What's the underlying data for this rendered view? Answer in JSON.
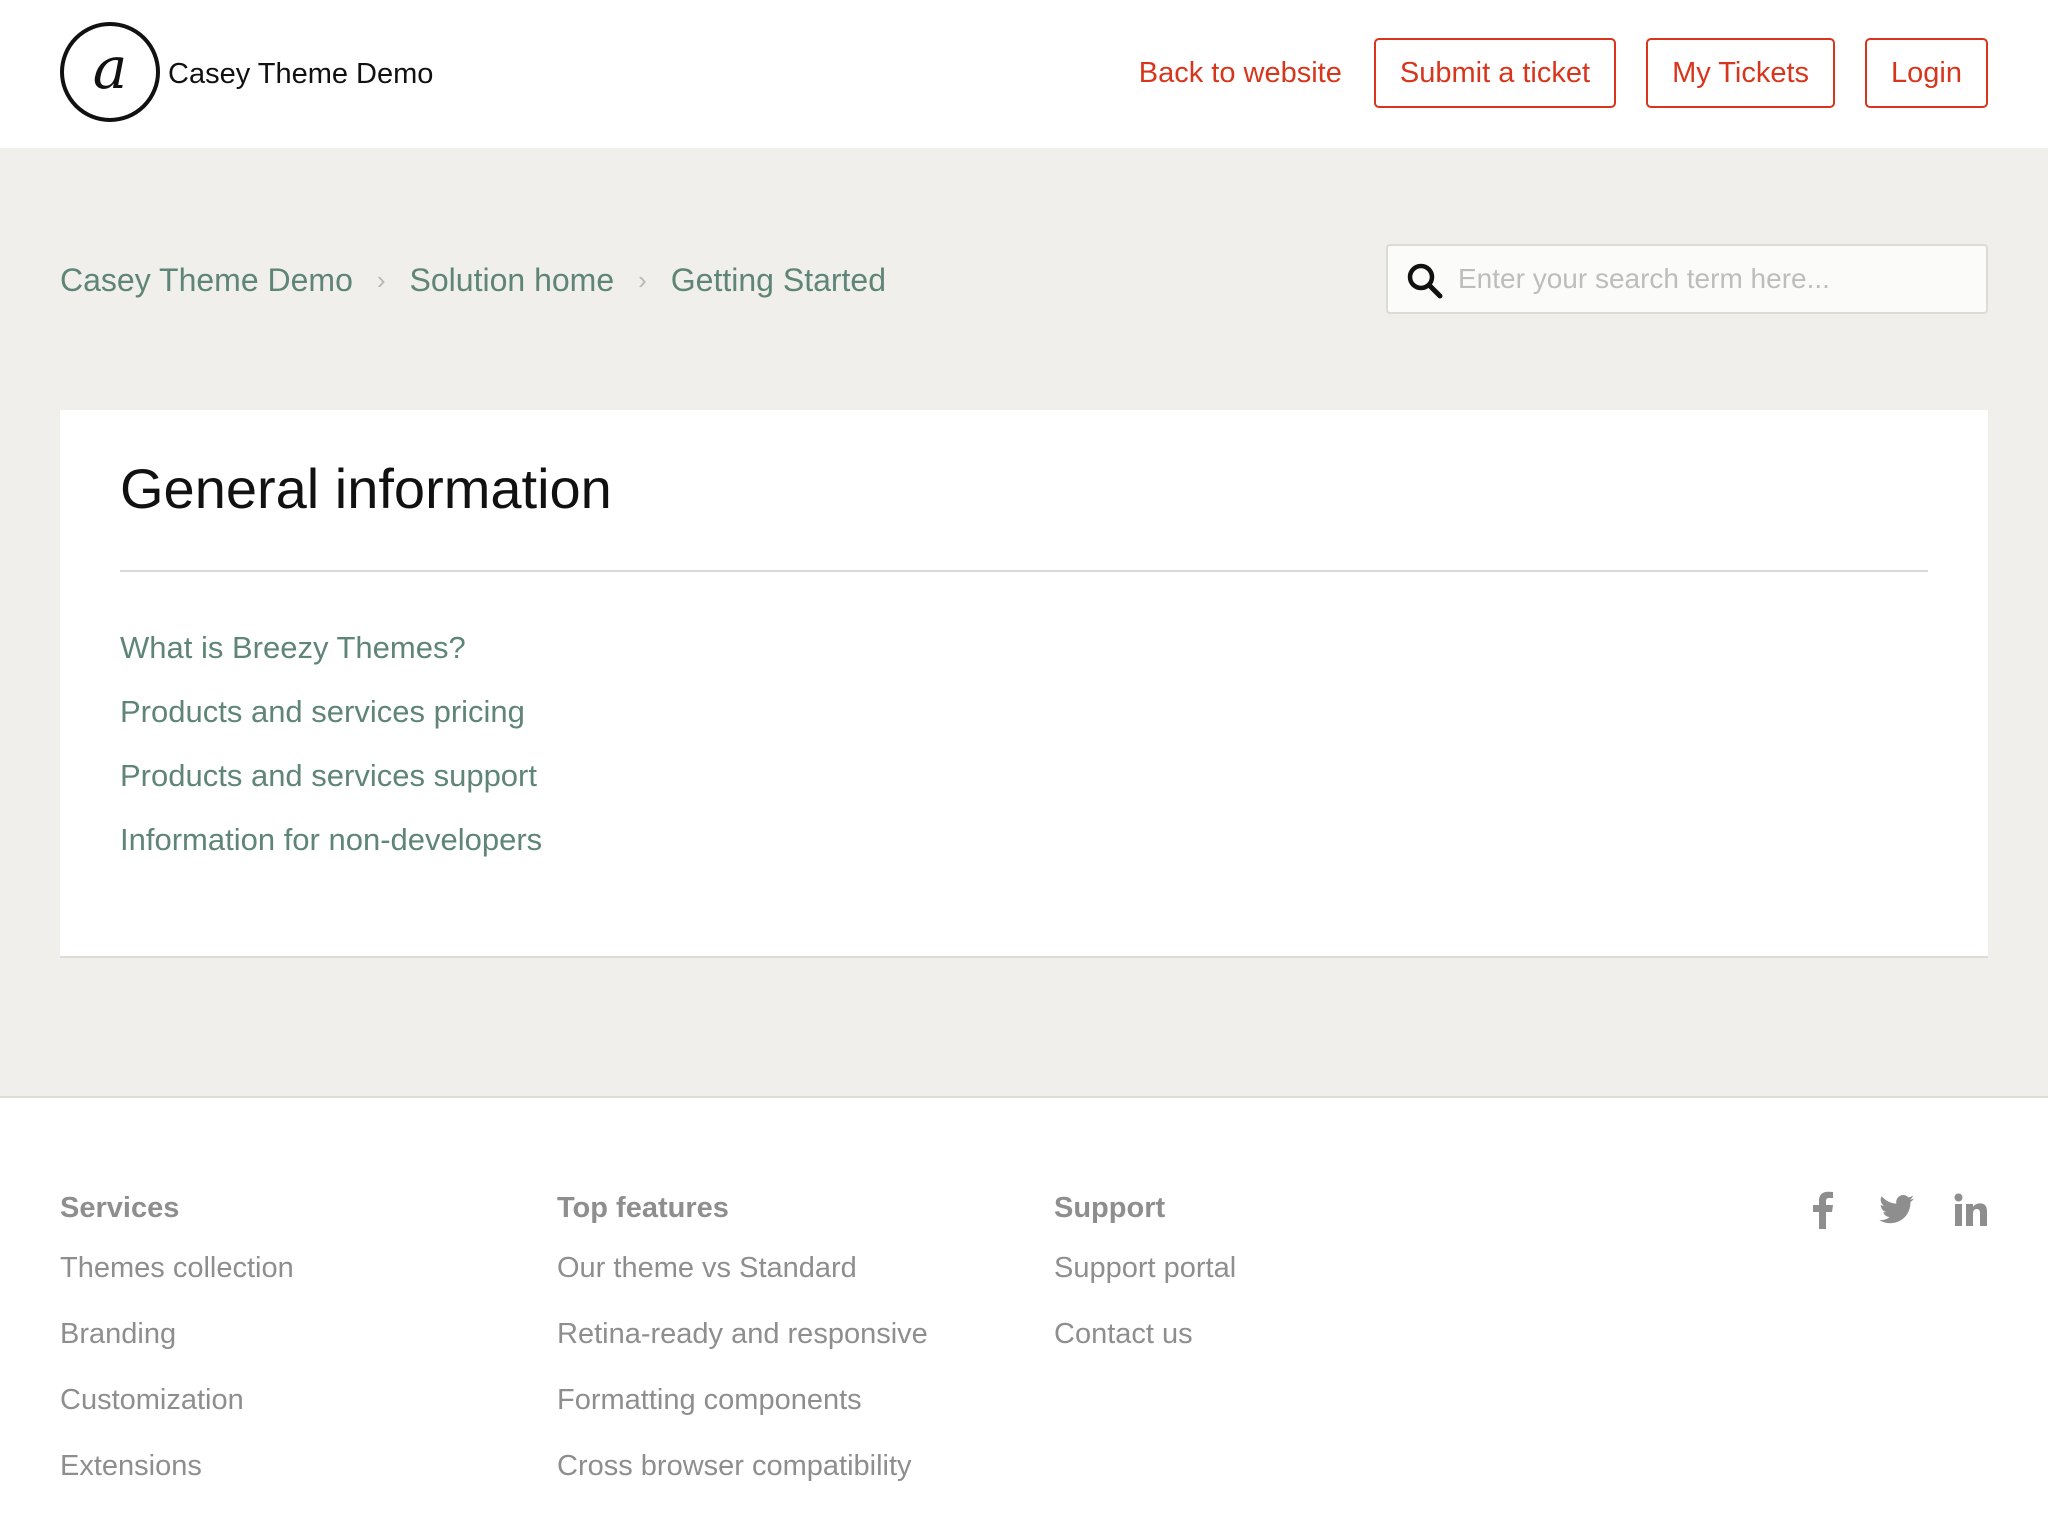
{
  "header": {
    "site_name": "Casey Theme Demo",
    "logo_glyph": "a",
    "back_link": "Back to website",
    "submit_ticket": "Submit a ticket",
    "my_tickets": "My Tickets",
    "login": "Login"
  },
  "breadcrumb": {
    "items": [
      "Casey Theme Demo",
      "Solution home",
      "Getting Started"
    ],
    "separator": "›"
  },
  "search": {
    "placeholder": "Enter your search term here..."
  },
  "section": {
    "title": "General information",
    "articles": [
      "What is Breezy Themes?",
      "Products and services pricing",
      "Products and services support",
      "Information for non-developers"
    ]
  },
  "footer": {
    "columns": [
      {
        "title": "Services",
        "links": [
          "Themes collection",
          "Branding",
          "Customization",
          "Extensions"
        ]
      },
      {
        "title": "Top features",
        "links": [
          "Our theme vs Standard",
          "Retina-ready and responsive",
          "Formatting components",
          "Cross browser compatibility"
        ]
      },
      {
        "title": "Support",
        "links": [
          "Support portal",
          "Contact us"
        ]
      }
    ],
    "social_icons": [
      "facebook-icon",
      "twitter-icon",
      "linkedin-icon"
    ]
  },
  "colors": {
    "accent": "#d7361c",
    "link_green": "#5e8577",
    "band_bg": "#f0efeb",
    "footer_text": "#8e8e8e"
  }
}
